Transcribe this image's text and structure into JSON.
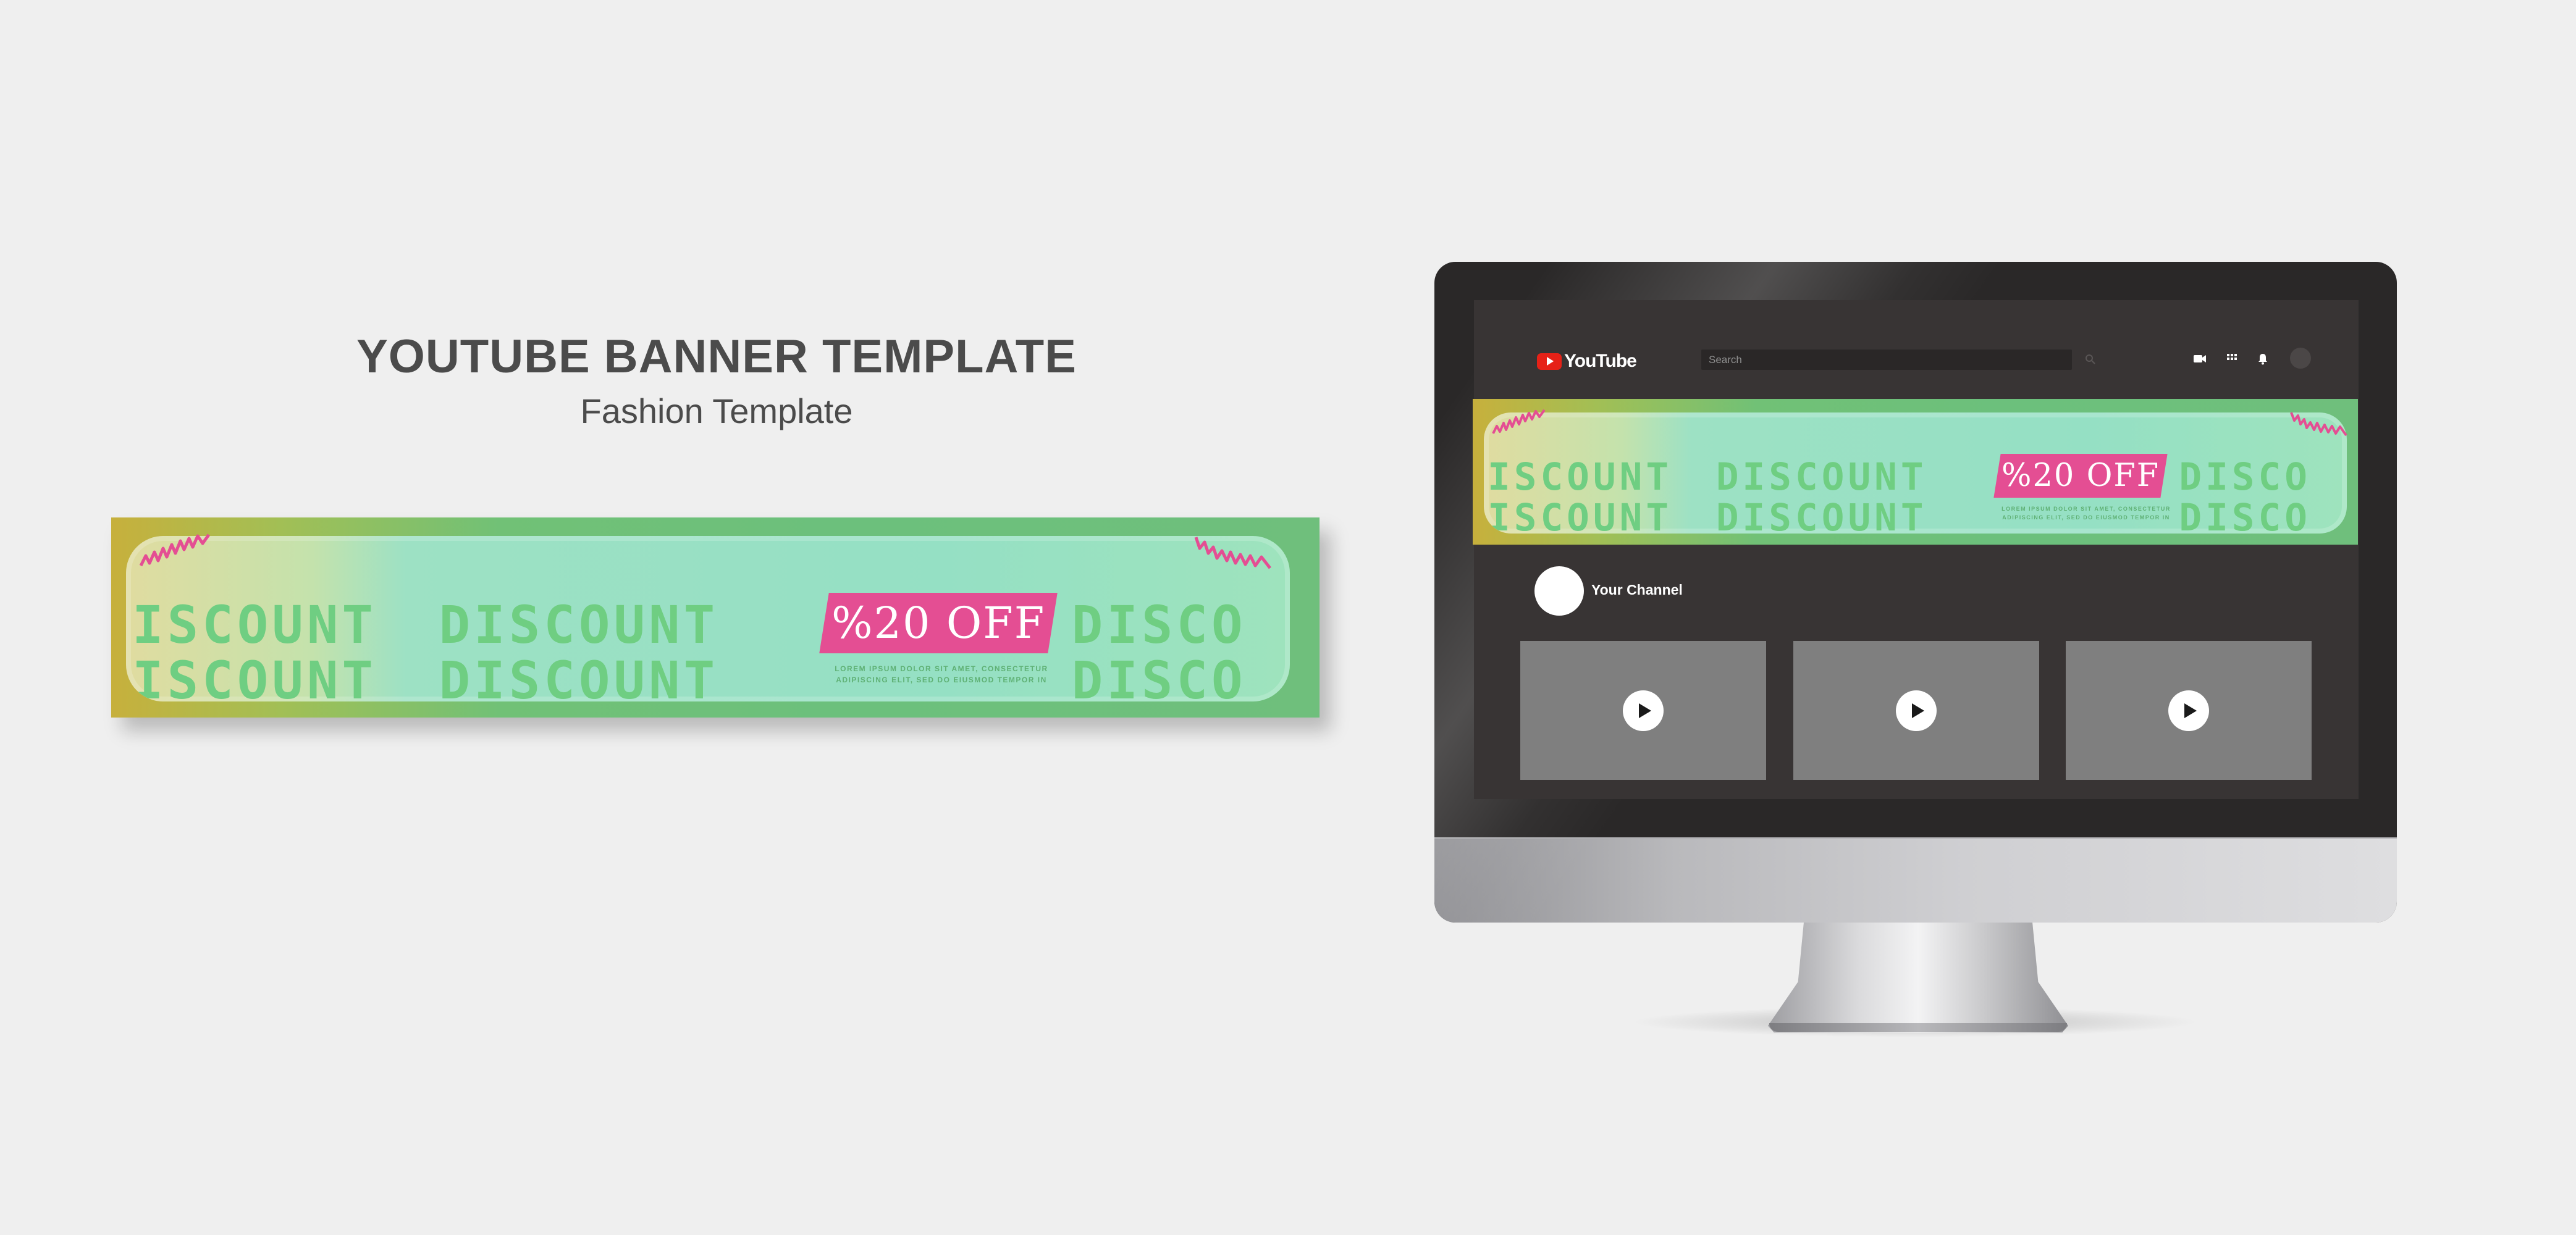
{
  "heading": {
    "title": "YOUTUBE BANNER TEMPLATE",
    "subtitle": "Fashion Template"
  },
  "banner": {
    "row_text": [
      "ISCOUNT",
      "DISCOUNT",
      "DISCO"
    ],
    "offer": "%20 OFF",
    "small_line_1": "LOREM IPSUM DOLOR SIT AMET, CONSECTETUR",
    "small_line_2": "ADIPISCING ELIT, SED DO EIUSMOD TEMPOR IN",
    "colors": {
      "green": "#6fbf7c",
      "yellow": "#c7b03c",
      "pink": "#e44e93",
      "text_green": "#6fce82"
    }
  },
  "youtube": {
    "logo_text": "YouTube",
    "search_placeholder": "Search",
    "icons": [
      "search-icon",
      "video-camera-icon",
      "apps-grid-icon",
      "bell-icon",
      "avatar"
    ],
    "channel_name": "Your Channel",
    "videos": [
      {
        "icon": "play-icon"
      },
      {
        "icon": "play-icon"
      },
      {
        "icon": "play-icon"
      }
    ],
    "colors": {
      "red": "#e62117",
      "screen_bg": "#383434"
    }
  }
}
